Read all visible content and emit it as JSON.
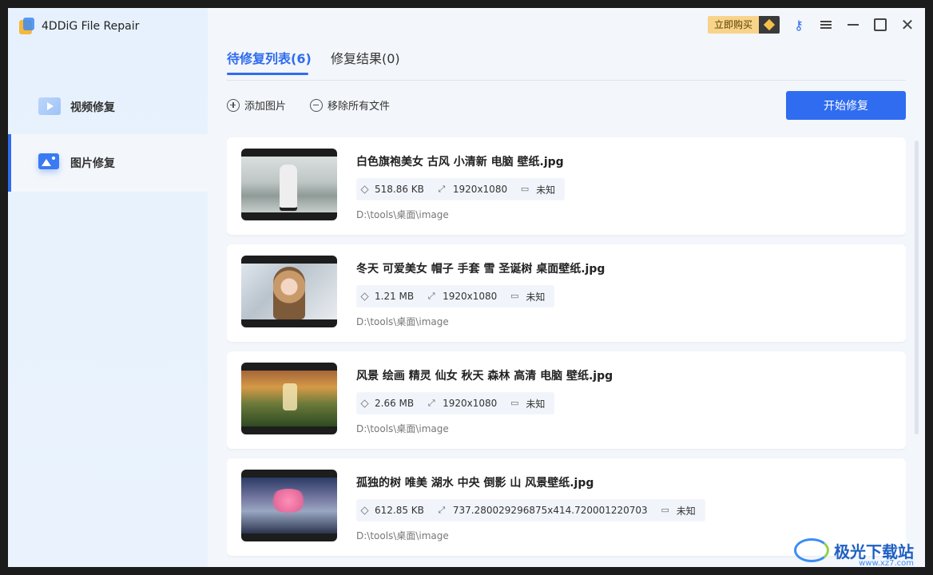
{
  "app": {
    "title": "4DDiG File Repair"
  },
  "sidebar": {
    "items": [
      {
        "label": "视频修复",
        "icon": "video-icon",
        "active": false
      },
      {
        "label": "图片修复",
        "icon": "image-icon",
        "active": true
      }
    ]
  },
  "titlebar": {
    "buy_label": "立即购买"
  },
  "tabs": [
    {
      "label": "待修复列表(6)",
      "active": true
    },
    {
      "label": "修复结果(0)",
      "active": false
    }
  ],
  "toolbar": {
    "add_label": "添加图片",
    "remove_label": "移除所有文件",
    "start_label": "开始修复"
  },
  "files": [
    {
      "name": "白色旗袍美女 古风 小清新 电脑 壁纸.jpg",
      "size": "518.86 KB",
      "resolution": "1920x1080",
      "duration": "未知",
      "path": "D:\\tools\\桌面\\image"
    },
    {
      "name": "冬天 可爱美女 帽子 手套 雪 圣诞树 桌面壁纸.jpg",
      "size": "1.21 MB",
      "resolution": "1920x1080",
      "duration": "未知",
      "path": "D:\\tools\\桌面\\image"
    },
    {
      "name": "风景 绘画 精灵 仙女 秋天 森林 高清 电脑 壁纸.jpg",
      "size": "2.66 MB",
      "resolution": "1920x1080",
      "duration": "未知",
      "path": "D:\\tools\\桌面\\image"
    },
    {
      "name": "孤独的树 唯美 湖水 中央 倒影 山 风景壁纸.jpg",
      "size": "612.85 KB",
      "resolution": "737.280029296875x414.720001220703",
      "duration": "未知",
      "path": "D:\\tools\\桌面\\image"
    }
  ],
  "watermark": {
    "text": "极光下载站",
    "url": "www.xz7.com"
  },
  "colors": {
    "accent": "#2f6cf0",
    "buy": "#f7d48a"
  }
}
